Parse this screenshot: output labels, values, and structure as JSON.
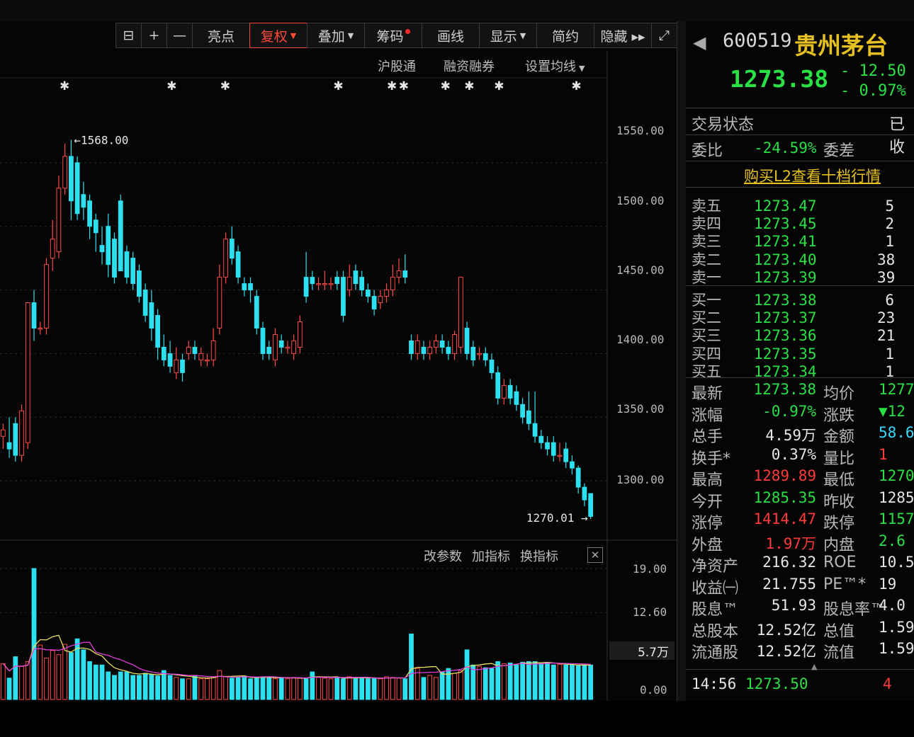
{
  "toolbar": {
    "items": [
      {
        "label": "",
        "icon": "lock-icon",
        "w": 37
      },
      {
        "label": "+",
        "icon": "zoom-in-icon",
        "w": 37
      },
      {
        "label": "—",
        "icon": "zoom-out-icon",
        "w": 37
      },
      {
        "label": "亮点",
        "w": 82
      },
      {
        "label": "复权",
        "active": true,
        "caret": true,
        "w": 82
      },
      {
        "label": "叠加",
        "caret": true,
        "w": 82
      },
      {
        "label": "筹码",
        "dot": true,
        "w": 82
      },
      {
        "label": "画线",
        "w": 82
      },
      {
        "label": "显示",
        "caret": true,
        "w": 82
      },
      {
        "label": "简约",
        "w": 82
      },
      {
        "label": "隐藏 ▸▸",
        "w": 82
      },
      {
        "label": "",
        "icon": "fullscreen-icon",
        "w": 37
      }
    ]
  },
  "subbar": {
    "hgt": "沪股通",
    "margin": "融资融券",
    "ma": "设置均线"
  },
  "indicator_bar": {
    "change_params": "改参数",
    "add_indicator": "加指标",
    "switch_indicator": "换指标",
    "close": "✕"
  },
  "chart_data": {
    "type": "candlestick",
    "y_ticks": [
      "1550.00",
      "1500.00",
      "1450.00",
      "1400.00",
      "1350.00",
      "1300.00"
    ],
    "volume_ticks": [
      "19.00",
      "12.60",
      "0.00"
    ],
    "volume_label": "5.7万",
    "high_label": "1568.00",
    "low_label": "1270.01",
    "ylim": [
      1255,
      1600
    ],
    "candles": [
      [
        1335,
        1340,
        1325,
        1345
      ],
      [
        1330,
        1325,
        1318,
        1350
      ],
      [
        1345,
        1320,
        1315,
        1350
      ],
      [
        1320,
        1355,
        1315,
        1360
      ],
      [
        1330,
        1440,
        1325,
        1440
      ],
      [
        1440,
        1420,
        1410,
        1450
      ],
      [
        1420,
        1420,
        1415,
        1425
      ],
      [
        1420,
        1470,
        1415,
        1475
      ],
      [
        1475,
        1490,
        1465,
        1505
      ],
      [
        1480,
        1530,
        1475,
        1540
      ],
      [
        1530,
        1555,
        1525,
        1565
      ],
      [
        1555,
        1520,
        1505,
        1568
      ],
      [
        1550,
        1510,
        1505,
        1555
      ],
      [
        1525,
        1515,
        1505,
        1535
      ],
      [
        1520,
        1500,
        1490,
        1525
      ],
      [
        1505,
        1495,
        1480,
        1510
      ],
      [
        1485,
        1480,
        1470,
        1500
      ],
      [
        1500,
        1470,
        1460,
        1510
      ],
      [
        1490,
        1460,
        1455,
        1495
      ],
      [
        1520,
        1465,
        1465,
        1525
      ],
      [
        1480,
        1460,
        1455,
        1485
      ],
      [
        1475,
        1455,
        1450,
        1480
      ],
      [
        1465,
        1445,
        1440,
        1470
      ],
      [
        1450,
        1430,
        1425,
        1455
      ],
      [
        1440,
        1420,
        1410,
        1450
      ],
      [
        1430,
        1405,
        1395,
        1435
      ],
      [
        1405,
        1395,
        1390,
        1415
      ],
      [
        1400,
        1390,
        1385,
        1410
      ],
      [
        1385,
        1395,
        1380,
        1405
      ],
      [
        1395,
        1385,
        1378,
        1400
      ],
      [
        1400,
        1405,
        1395,
        1410
      ],
      [
        1405,
        1400,
        1395,
        1410
      ],
      [
        1395,
        1400,
        1390,
        1405
      ],
      [
        1395,
        1395,
        1390,
        1400
      ],
      [
        1395,
        1410,
        1390,
        1420
      ],
      [
        1420,
        1460,
        1415,
        1470
      ],
      [
        1460,
        1490,
        1455,
        1495
      ],
      [
        1490,
        1475,
        1470,
        1500
      ],
      [
        1480,
        1460,
        1455,
        1485
      ],
      [
        1455,
        1450,
        1445,
        1460
      ],
      [
        1455,
        1450,
        1440,
        1460
      ],
      [
        1445,
        1420,
        1415,
        1450
      ],
      [
        1420,
        1400,
        1395,
        1425
      ],
      [
        1405,
        1400,
        1395,
        1410
      ],
      [
        1395,
        1415,
        1390,
        1420
      ],
      [
        1410,
        1405,
        1400,
        1415
      ],
      [
        1405,
        1405,
        1400,
        1410
      ],
      [
        1400,
        1410,
        1395,
        1415
      ],
      [
        1405,
        1425,
        1400,
        1430
      ],
      [
        1460,
        1445,
        1440,
        1480
      ],
      [
        1460,
        1455,
        1450,
        1465
      ],
      [
        1455,
        1455,
        1450,
        1460
      ],
      [
        1455,
        1455,
        1450,
        1465
      ],
      [
        1455,
        1455,
        1450,
        1460
      ],
      [
        1460,
        1455,
        1450,
        1465
      ],
      [
        1460,
        1430,
        1425,
        1465
      ],
      [
        1450,
        1460,
        1445,
        1470
      ],
      [
        1465,
        1455,
        1450,
        1470
      ],
      [
        1460,
        1450,
        1445,
        1465
      ],
      [
        1450,
        1445,
        1440,
        1455
      ],
      [
        1445,
        1435,
        1430,
        1450
      ],
      [
        1440,
        1445,
        1435,
        1450
      ],
      [
        1445,
        1450,
        1440,
        1455
      ],
      [
        1450,
        1460,
        1445,
        1470
      ],
      [
        1460,
        1465,
        1455,
        1475
      ],
      [
        1465,
        1460,
        1455,
        1478
      ],
      [
        1410,
        1400,
        1395,
        1415
      ],
      [
        1400,
        1410,
        1395,
        1415
      ],
      [
        1405,
        1400,
        1395,
        1410
      ],
      [
        1400,
        1405,
        1395,
        1410
      ],
      [
        1405,
        1410,
        1400,
        1415
      ],
      [
        1410,
        1405,
        1400,
        1415
      ],
      [
        1405,
        1400,
        1395,
        1410
      ],
      [
        1400,
        1415,
        1395,
        1418
      ],
      [
        1405,
        1460,
        1400,
        1460
      ],
      [
        1420,
        1400,
        1395,
        1425
      ],
      [
        1405,
        1395,
        1390,
        1410
      ],
      [
        1400,
        1400,
        1395,
        1405
      ],
      [
        1400,
        1395,
        1390,
        1405
      ],
      [
        1395,
        1385,
        1380,
        1400
      ],
      [
        1385,
        1365,
        1360,
        1390
      ],
      [
        1365,
        1375,
        1360,
        1380
      ],
      [
        1375,
        1365,
        1360,
        1380
      ],
      [
        1370,
        1360,
        1355,
        1375
      ],
      [
        1360,
        1350,
        1345,
        1365
      ],
      [
        1355,
        1345,
        1340,
        1370
      ],
      [
        1345,
        1335,
        1330,
        1370
      ],
      [
        1335,
        1330,
        1325,
        1340
      ],
      [
        1330,
        1325,
        1320,
        1335
      ],
      [
        1330,
        1320,
        1315,
        1335
      ],
      [
        1320,
        1320,
        1315,
        1330
      ],
      [
        1325,
        1315,
        1310,
        1330
      ],
      [
        1315,
        1310,
        1305,
        1320
      ],
      [
        1310,
        1295,
        1290,
        1312
      ],
      [
        1295,
        1285,
        1280,
        1298
      ],
      [
        1290,
        1272,
        1270,
        1290
      ]
    ],
    "volumes": [
      5.2,
      3.1,
      6.2,
      4.8,
      5.5,
      19.0,
      7.9,
      6.0,
      7.1,
      6.5,
      8.0,
      6.8,
      8.8,
      7.2,
      5.5,
      5.0,
      5.0,
      4.0,
      3.5,
      4.0,
      4.0,
      3.5,
      3.5,
      3.8,
      3.6,
      3.4,
      4.2,
      3.5,
      3.2,
      3.0,
      3.0,
      3.5,
      3.0,
      3.0,
      3.2,
      4.2,
      3.3,
      3.1,
      3.2,
      3.4,
      3.0,
      3.2,
      3.3,
      3.2,
      3.0,
      3.2,
      3.0,
      3.2,
      3.1,
      3.0,
      4.0,
      3.2,
      3.1,
      3.0,
      3.2,
      3.0,
      3.3,
      3.1,
      3.2,
      3.0,
      3.1,
      3.0,
      3.3,
      3.2,
      3.1,
      3.0,
      9.5,
      4.5,
      3.2,
      3.5,
      3.2,
      4.0,
      4.5,
      3.8,
      4.2,
      7.2,
      5.0,
      4.8,
      4.6,
      4.5,
      5.5,
      5.2,
      5.3,
      5.0,
      5.4,
      5.5,
      5.5,
      5.2,
      5.3,
      5.0,
      5.1,
      5.0,
      5.0,
      4.9,
      5.0,
      5.0
    ],
    "star_positions_pct": [
      10,
      28,
      37,
      56,
      65,
      67,
      74,
      78,
      83,
      96
    ]
  },
  "quote": {
    "code": "600519",
    "name": "贵州茅台",
    "price": "1273.38",
    "change": "- 12.50",
    "change_pct": "- 0.97%",
    "trade_status_label": "交易状态",
    "trade_status_value": "已收",
    "weibi_label": "委比",
    "weibi_value": "-24.59%",
    "weicha_label": "委差",
    "l2_link": "购买L2查看十档行情",
    "asks": [
      {
        "label": "卖五",
        "price": "1273.47",
        "vol": "5"
      },
      {
        "label": "卖四",
        "price": "1273.45",
        "vol": "2"
      },
      {
        "label": "卖三",
        "price": "1273.41",
        "vol": "1"
      },
      {
        "label": "卖二",
        "price": "1273.40",
        "vol": "38"
      },
      {
        "label": "卖一",
        "price": "1273.39",
        "vol": "39"
      }
    ],
    "bids": [
      {
        "label": "买一",
        "price": "1273.38",
        "vol": "6"
      },
      {
        "label": "买二",
        "price": "1273.37",
        "vol": "23"
      },
      {
        "label": "买三",
        "price": "1273.36",
        "vol": "21"
      },
      {
        "label": "买四",
        "price": "1273.35",
        "vol": "1"
      },
      {
        "label": "买五",
        "price": "1273.34",
        "vol": "1"
      }
    ],
    "stats": [
      {
        "l1": "最新",
        "v1": "1273.38",
        "c1": "green",
        "l2": "均价",
        "v2": "1277",
        "c2": "green"
      },
      {
        "l1": "涨幅",
        "v1": "-0.97%",
        "c1": "green",
        "l2": "涨跌",
        "v2": "▼12",
        "c2": "green"
      },
      {
        "l1": "总手",
        "v1": "4.59万",
        "c1": "white",
        "l2": "金额",
        "v2": "58.6",
        "c2": "cyan"
      },
      {
        "l1": "换手*",
        "v1": "0.37%",
        "c1": "white",
        "l2": "量比",
        "v2": "1",
        "c2": "red"
      },
      {
        "l1": "最高",
        "v1": "1289.89",
        "c1": "red",
        "l2": "最低",
        "v2": "1270",
        "c2": "green"
      },
      {
        "l1": "今开",
        "v1": "1285.35",
        "c1": "green",
        "l2": "昨收",
        "v2": "1285",
        "c2": "white"
      },
      {
        "l1": "涨停",
        "v1": "1414.47",
        "c1": "red",
        "l2": "跌停",
        "v2": "1157",
        "c2": "green"
      },
      {
        "l1": "外盘",
        "v1": "1.97万",
        "c1": "red",
        "l2": "内盘",
        "v2": "2.6",
        "c2": "green"
      },
      {
        "l1": "净资产",
        "v1": "216.32",
        "c1": "white",
        "l2": "ROE",
        "v2": "10.5",
        "c2": "white"
      },
      {
        "l1": "收益㈠",
        "v1": "21.755",
        "c1": "white",
        "l2": "PE™*",
        "v2": "19",
        "c2": "white"
      },
      {
        "l1": "股息™",
        "v1": "51.93",
        "c1": "white",
        "l2": "股息率™",
        "v2": "4.0",
        "c2": "white"
      },
      {
        "l1": "总股本",
        "v1": "12.52亿",
        "c1": "white",
        "l2": "总值",
        "v2": "1.59",
        "c2": "white"
      },
      {
        "l1": "流通股",
        "v1": "12.52亿",
        "c1": "white",
        "l2": "流值",
        "v2": "1.59",
        "c2": "white"
      }
    ],
    "tick": {
      "time": "14:56",
      "price": "1273.50",
      "vol": "4"
    }
  },
  "colors": {
    "up": "#ff4a4a",
    "down": "#2de0f0",
    "ma1": "#e8e060",
    "ma2": "#e040e0"
  }
}
